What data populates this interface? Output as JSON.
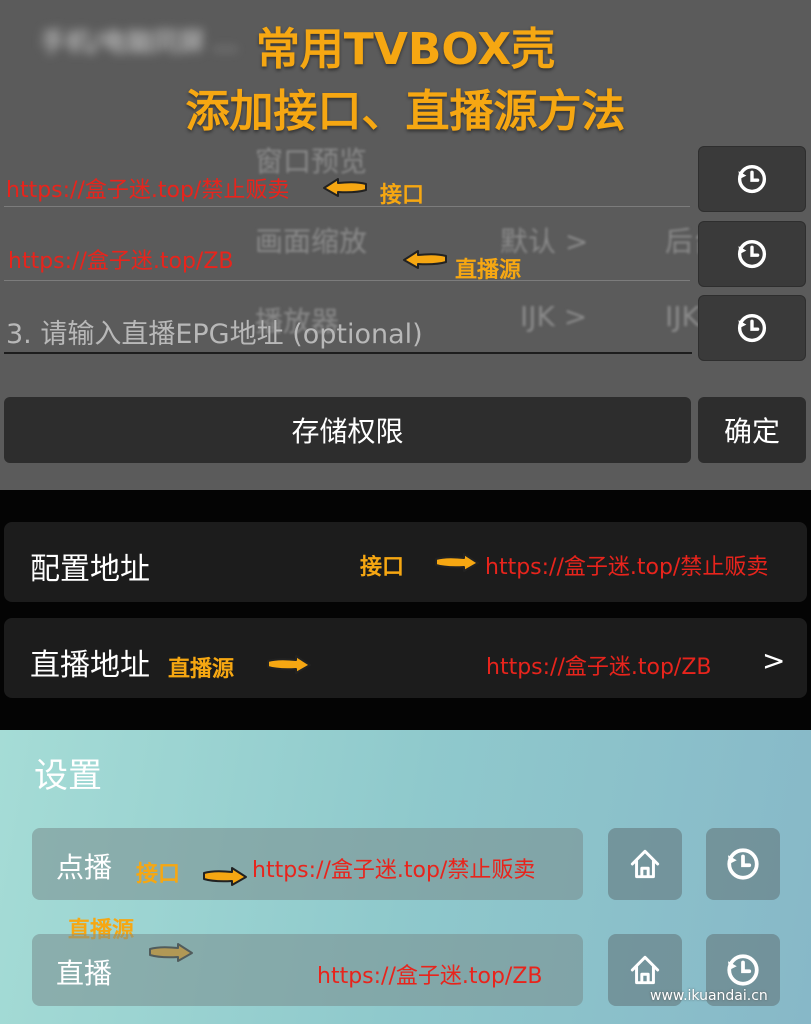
{
  "headline": {
    "line1": "常用TVBOX壳",
    "line2": "添加接口、直播源方法"
  },
  "blurred_background": {
    "top_text": "手机/电脑同屏 ...",
    "preview": "窗口预览",
    "mid_left": "画面缩放",
    "mid_default": "默认 >",
    "mid_right": "后台",
    "low_left": "播放器",
    "low_ijk": "IJK >",
    "low_right": "IJK"
  },
  "dialog": {
    "api_url": "https://盒子迷.top/禁止贩卖",
    "api_anno": "接口",
    "live_url": "https://盒子迷.top/ZB",
    "live_anno": "直播源",
    "epg_placeholder": "3. 请输入直播EPG地址 (optional)",
    "storage_button": "存储权限",
    "confirm_button": "确定"
  },
  "config_panel": {
    "config_label": "配置地址",
    "config_anno": "接口",
    "config_url": "https://盒子迷.top/禁止贩卖",
    "live_label": "直播地址",
    "live_anno": "直播源",
    "live_url": "https://盒子迷.top/ZB",
    "chevron": ">"
  },
  "settings": {
    "title": "设置",
    "vod_label": "点播",
    "vod_anno": "接口",
    "vod_url": "https://盒子迷.top/禁止贩卖",
    "live_label": "直播",
    "live_anno": "直播源",
    "live_url": "https://盒子迷.top/ZB"
  },
  "watermark": "www.ikuandai.cn",
  "colors": {
    "annotation": "#f6a712",
    "url_red": "#e8241c"
  },
  "icons": [
    "history-icon",
    "home-icon",
    "arrow-left-icon",
    "arrow-right-icon"
  ]
}
